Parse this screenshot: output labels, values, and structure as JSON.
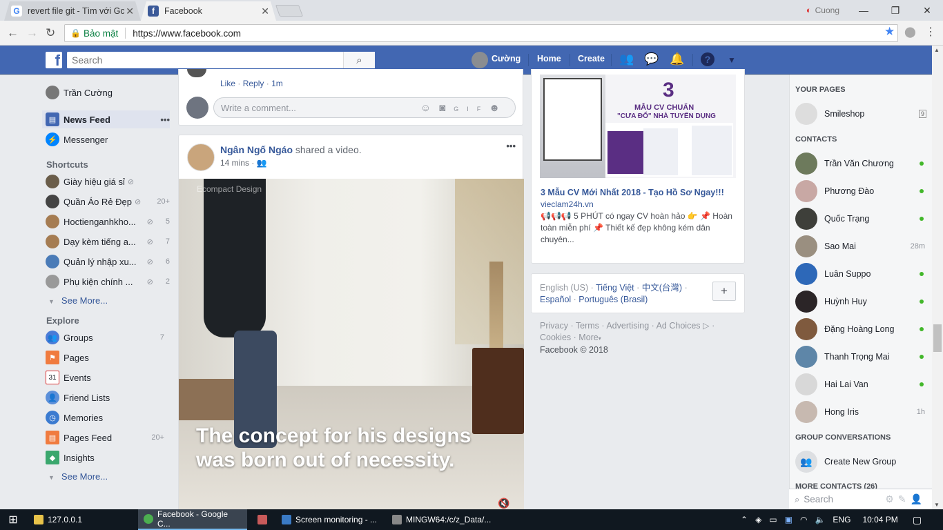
{
  "browser": {
    "tabs": [
      {
        "title": "revert file git - Tìm với Gc"
      },
      {
        "title": "Facebook"
      }
    ],
    "profile_name": "Cuong",
    "secure_label": "Bảo mật",
    "url": "https://www.facebook.com"
  },
  "fb_header": {
    "search_placeholder": "Search",
    "user_name": "Cường",
    "home": "Home",
    "create": "Create"
  },
  "left_nav": {
    "profile": "Trần Cường",
    "main": [
      {
        "label": "News Feed"
      },
      {
        "label": "Messenger"
      }
    ],
    "shortcuts_title": "Shortcuts",
    "shortcuts": [
      {
        "label": "Giày hiệu giá sỉ",
        "count": ""
      },
      {
        "label": "Quần Áo Rẻ Đẹp",
        "count": "20+"
      },
      {
        "label": "Hoctienganhkho...",
        "count": "5"
      },
      {
        "label": "Dạy kèm tiếng a...",
        "count": "7"
      },
      {
        "label": "Quản lý nhập xu...",
        "count": "6"
      },
      {
        "label": "Phụ kiện chính ...",
        "count": "2"
      }
    ],
    "see_more_1": "See More...",
    "explore_title": "Explore",
    "explore": [
      {
        "label": "Groups",
        "count": "7"
      },
      {
        "label": "Pages",
        "count": ""
      },
      {
        "label": "Events",
        "count": ""
      },
      {
        "label": "Friend Lists",
        "count": ""
      },
      {
        "label": "Memories",
        "count": ""
      },
      {
        "label": "Pages Feed",
        "count": "20+"
      },
      {
        "label": "Insights",
        "count": ""
      }
    ],
    "see_more_2": "See More..."
  },
  "feed": {
    "comment_actions": {
      "like": "Like",
      "reply": "Reply",
      "time": "1m"
    },
    "comment_placeholder": "Write a comment...",
    "post": {
      "author": "Ngân Ngố Ngáo",
      "action": "shared a video.",
      "time": "14 mins",
      "watermark": "Ecompact Design",
      "caption_line1": "The concept for his designs",
      "caption_line2": "was born out of necessity."
    }
  },
  "ad": {
    "image_big": "3",
    "image_line1": "MẪU CV CHUẨN",
    "image_line2": "\"CƯA ĐỔ\" NHÀ TUYỂN DỤNG",
    "title": "3 Mẫu CV Mới Nhất 2018 - Tạo Hồ Sơ Ngay!!!",
    "domain": "vieclam24h.vn",
    "text": "📢📢📢 5 PHÚT có ngay CV hoàn hảo 👉 📌 Hoàn toàn miễn phí 📌 Thiết kế đẹp không kém dân chuyên..."
  },
  "languages": {
    "current": "English (US)",
    "others": [
      "Tiếng Việt",
      "中文(台灣)",
      "Español",
      "Português (Brasil)"
    ]
  },
  "footer": {
    "links": [
      "Privacy",
      "Terms",
      "Advertising",
      "Ad Choices",
      "Cookies",
      "More"
    ],
    "copyright": "Facebook © 2018"
  },
  "chat": {
    "your_pages_title": "YOUR PAGES",
    "page_name": "Smileshop",
    "page_count": "9",
    "contacts_title": "CONTACTS",
    "contacts": [
      {
        "name": "Trần Văn Chương",
        "status": "online",
        "time": ""
      },
      {
        "name": "Phương Đào",
        "status": "online",
        "time": ""
      },
      {
        "name": "Quốc Trạng",
        "status": "online",
        "time": ""
      },
      {
        "name": "Sao Mai",
        "status": "idle",
        "time": "28m"
      },
      {
        "name": "Luân Suppo",
        "status": "online",
        "time": ""
      },
      {
        "name": "Huỳnh Huy",
        "status": "online",
        "time": ""
      },
      {
        "name": "Đặng Hoàng Long",
        "status": "online",
        "time": ""
      },
      {
        "name": "Thanh Trọng Mai",
        "status": "online",
        "time": ""
      },
      {
        "name": "Hai Lai Van",
        "status": "online",
        "time": ""
      },
      {
        "name": "Hong Iris",
        "status": "idle",
        "time": "1h"
      }
    ],
    "group_title": "GROUP CONVERSATIONS",
    "create_group": "Create New Group",
    "more_contacts": "MORE CONTACTS (26)",
    "search_placeholder": "Search"
  },
  "taskbar": {
    "items": [
      {
        "label": "127.0.0.1"
      },
      {
        "label": "Facebook - Google C..."
      },
      {
        "label": ""
      },
      {
        "label": "Screen monitoring - ..."
      },
      {
        "label": "MINGW64:/c/z_Data/..."
      }
    ],
    "lang": "ENG",
    "time": "10:04 PM"
  },
  "colors": {
    "fb_blue": "#4267b2",
    "link": "#365899",
    "online": "#42b72a"
  }
}
